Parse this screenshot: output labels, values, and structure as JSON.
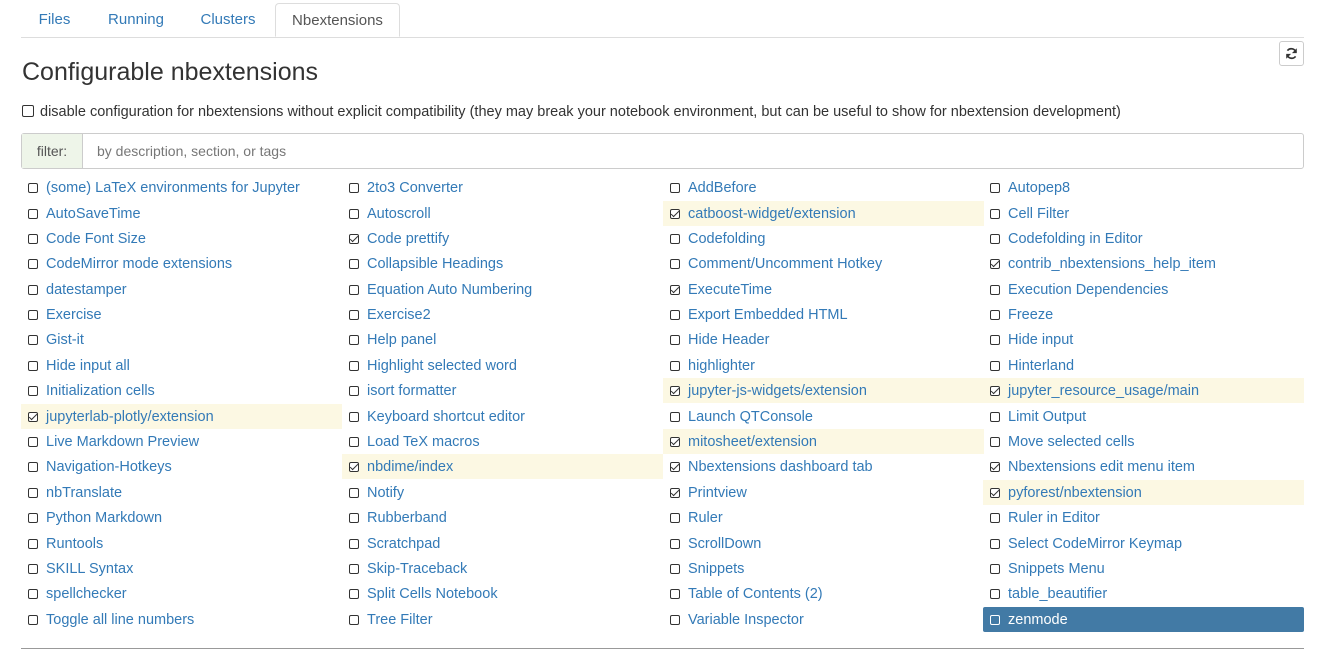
{
  "tabs": [
    "Files",
    "Running",
    "Clusters",
    "Nbextensions"
  ],
  "active_tab": "Nbextensions",
  "refresh_icon": "refresh-icon",
  "page_title": "Configurable nbextensions",
  "compat_label": "disable configuration for nbextensions without explicit compatibility (they may break your notebook environment, but can be useful to show for nbextension development)",
  "compat_checked": false,
  "filter": {
    "label": "filter:",
    "placeholder": "by description, section, or tags",
    "value": ""
  },
  "colors": {
    "link": "#337ab7",
    "enabled_bg": "#fcf8e3",
    "selected_bg": "#427aa5",
    "filter_bg": "#eef5e9"
  },
  "extensions": [
    [
      {
        "label": "(some) LaTeX environments for Jupyter",
        "checked": false
      },
      {
        "label": "AutoSaveTime",
        "checked": false
      },
      {
        "label": "Code Font Size",
        "checked": false
      },
      {
        "label": "CodeMirror mode extensions",
        "checked": false
      },
      {
        "label": "datestamper",
        "checked": false
      },
      {
        "label": "Exercise",
        "checked": false
      },
      {
        "label": "Gist-it",
        "checked": false
      },
      {
        "label": "Hide input all",
        "checked": false
      },
      {
        "label": "Initialization cells",
        "checked": false
      },
      {
        "label": "jupyterlab-plotly/extension",
        "checked": true
      },
      {
        "label": "Live Markdown Preview",
        "checked": false
      },
      {
        "label": "Navigation-Hotkeys",
        "checked": false
      },
      {
        "label": "nbTranslate",
        "checked": false
      },
      {
        "label": "Python Markdown",
        "checked": false
      },
      {
        "label": "Runtools",
        "checked": false
      },
      {
        "label": "SKILL Syntax",
        "checked": false
      },
      {
        "label": "spellchecker",
        "checked": false
      },
      {
        "label": "Toggle all line numbers",
        "checked": false
      }
    ],
    [
      {
        "label": "2to3 Converter",
        "checked": false
      },
      {
        "label": "Autoscroll",
        "checked": false
      },
      {
        "label": "Code prettify",
        "checked": true,
        "highlight": false
      },
      {
        "label": "Collapsible Headings",
        "checked": false
      },
      {
        "label": "Equation Auto Numbering",
        "checked": false
      },
      {
        "label": "Exercise2",
        "checked": false
      },
      {
        "label": "Help panel",
        "checked": false
      },
      {
        "label": "Highlight selected word",
        "checked": false
      },
      {
        "label": "isort formatter",
        "checked": false
      },
      {
        "label": "Keyboard shortcut editor",
        "checked": false
      },
      {
        "label": "Load TeX macros",
        "checked": false
      },
      {
        "label": "nbdime/index",
        "checked": true
      },
      {
        "label": "Notify",
        "checked": false
      },
      {
        "label": "Rubberband",
        "checked": false
      },
      {
        "label": "Scratchpad",
        "checked": false
      },
      {
        "label": "Skip-Traceback",
        "checked": false
      },
      {
        "label": "Split Cells Notebook",
        "checked": false
      },
      {
        "label": "Tree Filter",
        "checked": false
      }
    ],
    [
      {
        "label": "AddBefore",
        "checked": false
      },
      {
        "label": "catboost-widget/extension",
        "checked": true
      },
      {
        "label": "Codefolding",
        "checked": false
      },
      {
        "label": "Comment/Uncomment Hotkey",
        "checked": false
      },
      {
        "label": "ExecuteTime",
        "checked": true,
        "highlight": false
      },
      {
        "label": "Export Embedded HTML",
        "checked": false
      },
      {
        "label": "Hide Header",
        "checked": false
      },
      {
        "label": "highlighter",
        "checked": false
      },
      {
        "label": "jupyter-js-widgets/extension",
        "checked": true
      },
      {
        "label": "Launch QTConsole",
        "checked": false
      },
      {
        "label": "mitosheet/extension",
        "checked": true
      },
      {
        "label": "Nbextensions dashboard tab",
        "checked": true,
        "highlight": false
      },
      {
        "label": "Printview",
        "checked": true,
        "highlight": false
      },
      {
        "label": "Ruler",
        "checked": false
      },
      {
        "label": "ScrollDown",
        "checked": false
      },
      {
        "label": "Snippets",
        "checked": false
      },
      {
        "label": "Table of Contents (2)",
        "checked": false
      },
      {
        "label": "Variable Inspector",
        "checked": false
      }
    ],
    [
      {
        "label": "Autopep8",
        "checked": false
      },
      {
        "label": "Cell Filter",
        "checked": false
      },
      {
        "label": "Codefolding in Editor",
        "checked": false
      },
      {
        "label": "contrib_nbextensions_help_item",
        "checked": true,
        "highlight": false
      },
      {
        "label": "Execution Dependencies",
        "checked": false
      },
      {
        "label": "Freeze",
        "checked": false
      },
      {
        "label": "Hide input",
        "checked": false
      },
      {
        "label": "Hinterland",
        "checked": false
      },
      {
        "label": "jupyter_resource_usage/main",
        "checked": true
      },
      {
        "label": "Limit Output",
        "checked": false
      },
      {
        "label": "Move selected cells",
        "checked": false
      },
      {
        "label": "Nbextensions edit menu item",
        "checked": true,
        "highlight": false
      },
      {
        "label": "pyforest/nbextension",
        "checked": true
      },
      {
        "label": "Ruler in Editor",
        "checked": false
      },
      {
        "label": "Select CodeMirror Keymap",
        "checked": false
      },
      {
        "label": "Snippets Menu",
        "checked": false
      },
      {
        "label": "table_beautifier",
        "checked": false
      },
      {
        "label": "zenmode",
        "checked": false,
        "selected": true
      }
    ]
  ]
}
